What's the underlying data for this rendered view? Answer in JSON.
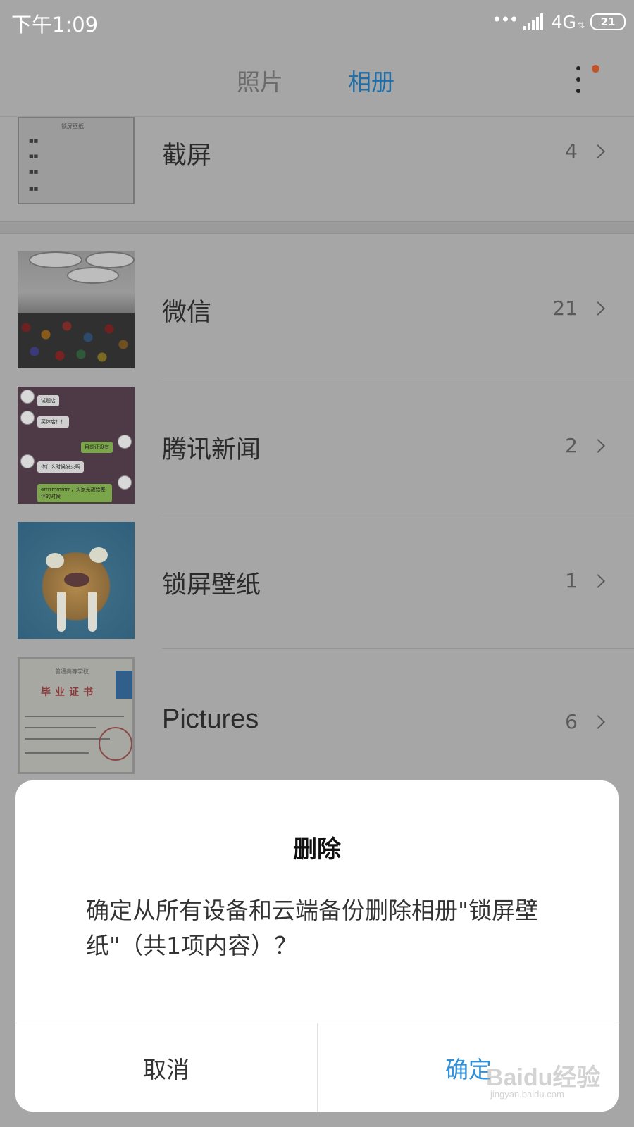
{
  "status_bar": {
    "time": "下午1:09",
    "network": "4G",
    "battery": "21"
  },
  "tabs": {
    "photos": "照片",
    "albums": "相册",
    "active": "albums"
  },
  "albums": [
    {
      "name": "截屏",
      "count": "4",
      "thumb": "screenshot",
      "thumb_title": "锁屏壁纸",
      "thumb_lines": [
        "■■",
        "■■",
        "■■",
        "■■"
      ]
    },
    {
      "name": "微信",
      "count": "21",
      "thumb": "classroom"
    },
    {
      "name": "腾讯新闻",
      "count": "2",
      "thumb": "chat",
      "thumb_bubbles": [
        "试题店",
        "买体店！！",
        "目前还没有",
        "你什么时候发火啊",
        "errrrmmmm，买家无故给差评的时候"
      ]
    },
    {
      "name": "锁屏壁纸",
      "count": "1",
      "thumb": "tiger"
    },
    {
      "name": "Pictures",
      "count": "6",
      "thumb": "certificate",
      "thumb_head": "普通高等学校",
      "thumb_title": "毕业证书"
    }
  ],
  "dialog": {
    "title": "删除",
    "message": "确定从所有设备和云端备份删除相册\"锁屏壁纸\"（共1项内容）？",
    "cancel_label": "取消",
    "confirm_label": "确定"
  },
  "watermark": {
    "text": "Baidu经验",
    "url": "jingyan.baidu.com"
  },
  "colors": {
    "accent": "#2f8fd8",
    "active_tab": "#1f6ea8",
    "badge": "#c25429",
    "dim_overlay_bg": "#a6a6a6"
  }
}
